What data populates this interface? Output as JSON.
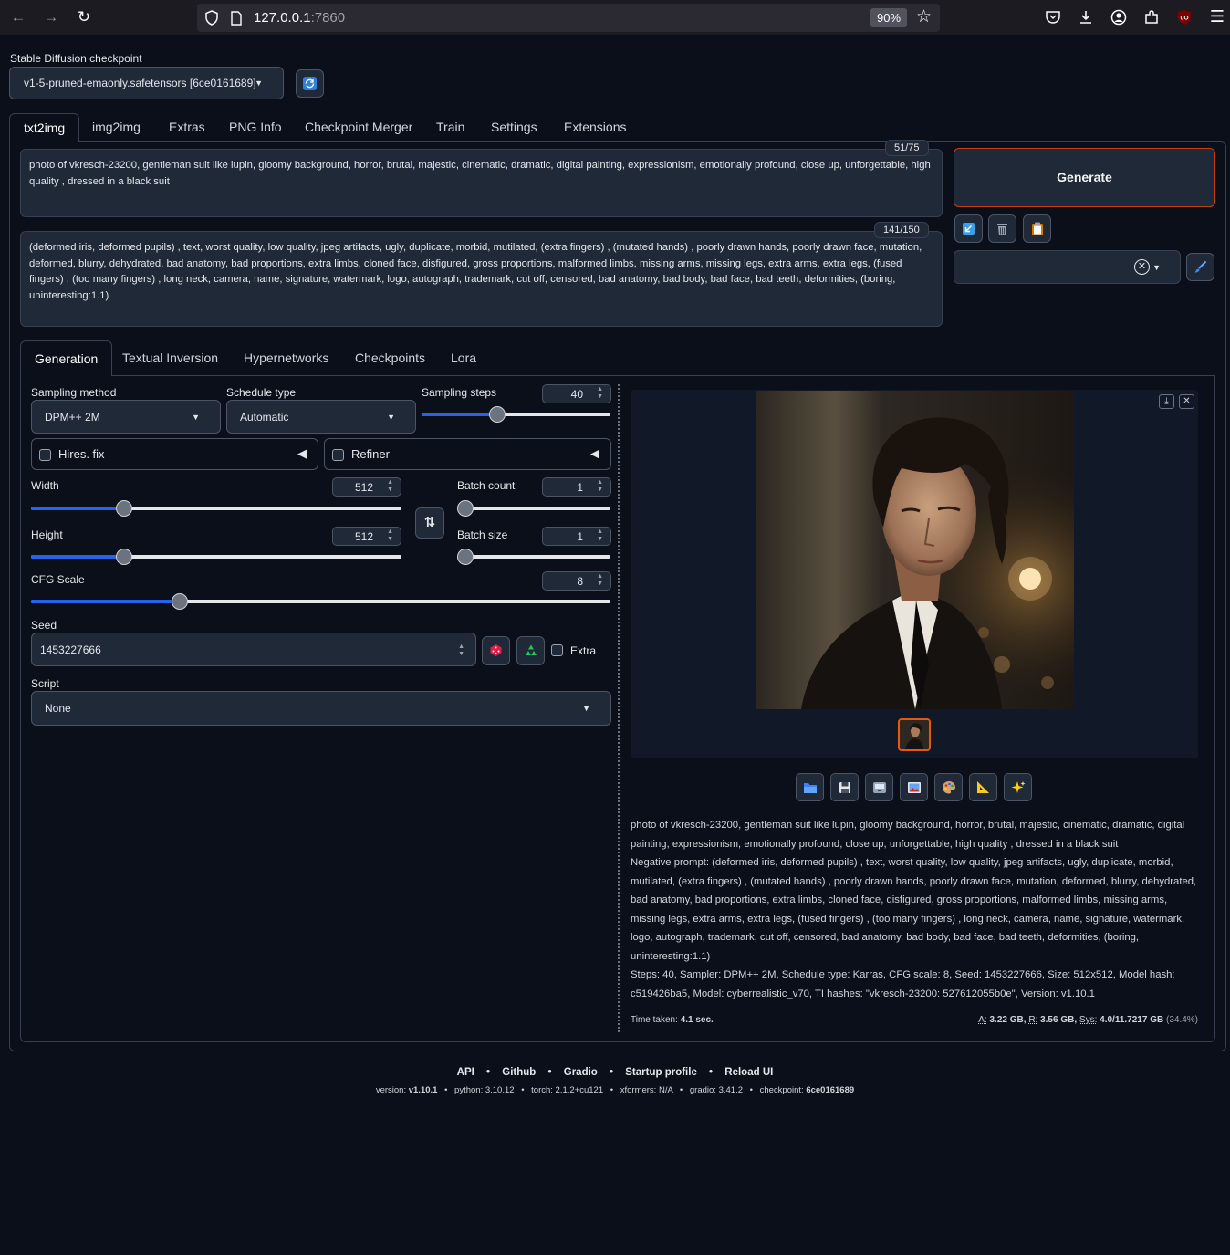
{
  "browser": {
    "url_host": "127.0.0.1",
    "url_port": ":7860",
    "zoom": "90%"
  },
  "checkpoint": {
    "label": "Stable Diffusion checkpoint",
    "value": "v1-5-pruned-emaonly.safetensors [6ce0161689]"
  },
  "main_tabs": [
    "txt2img",
    "img2img",
    "Extras",
    "PNG Info",
    "Checkpoint Merger",
    "Train",
    "Settings",
    "Extensions"
  ],
  "prompt": {
    "text": "photo of vkresch-23200, gentleman suit like lupin, gloomy background, horror, brutal, majestic, cinematic, dramatic, digital painting, expressionism, emotionally profound, close up, unforgettable, high quality , dressed in a black suit",
    "counter": "51/75"
  },
  "negative_prompt": {
    "text": "(deformed iris, deformed pupils) , text, worst quality, low quality, jpeg artifacts, ugly, duplicate, morbid, mutilated, (extra fingers) , (mutated hands) , poorly drawn hands, poorly drawn face, mutation, deformed, blurry, dehydrated, bad anatomy, bad proportions, extra limbs, cloned face, disfigured, gross proportions, malformed limbs, missing arms, missing legs, extra arms, extra legs, (fused fingers) , (too many fingers) , long neck, camera, name, signature, watermark, logo, autograph, trademark, cut off, censored, bad anatomy, bad body, bad face, bad teeth, deformities, (boring, uninteresting:1.1)",
    "counter": "141/150"
  },
  "generate_label": "Generate",
  "sub_tabs": [
    "Generation",
    "Textual Inversion",
    "Hypernetworks",
    "Checkpoints",
    "Lora"
  ],
  "params": {
    "sampling_method_label": "Sampling method",
    "sampling_method": "DPM++ 2M",
    "schedule_type_label": "Schedule type",
    "schedule_type": "Automatic",
    "sampling_steps_label": "Sampling steps",
    "sampling_steps": "40",
    "hires_fix": "Hires. fix",
    "refiner": "Refiner",
    "width_label": "Width",
    "width": "512",
    "height_label": "Height",
    "height": "512",
    "batch_count_label": "Batch count",
    "batch_count": "1",
    "batch_size_label": "Batch size",
    "batch_size": "1",
    "cfg_label": "CFG Scale",
    "cfg": "8",
    "seed_label": "Seed",
    "seed": "1453227666",
    "extra_label": "Extra",
    "script_label": "Script",
    "script": "None"
  },
  "sliders": {
    "sampling_steps": 0.39,
    "width": 0.24,
    "height": 0.24,
    "batch_count": 0.0,
    "batch_size": 0.0,
    "cfg": 0.25
  },
  "output": {
    "info_line1": "photo of vkresch-23200, gentleman suit like lupin, gloomy background, horror, brutal, majestic, cinematic, dramatic, digital painting, expressionism, emotionally profound, close up, unforgettable, high quality , dressed in a black suit",
    "info_line2": "Negative prompt: (deformed iris, deformed pupils) , text, worst quality, low quality, jpeg artifacts, ugly, duplicate, morbid, mutilated, (extra fingers) , (mutated hands) , poorly drawn hands, poorly drawn face, mutation, deformed, blurry, dehydrated, bad anatomy, bad proportions, extra limbs, cloned face, disfigured, gross proportions, malformed limbs, missing arms, missing legs, extra arms, extra legs, (fused fingers) , (too many fingers) , long neck, camera, name, signature, watermark, logo, autograph, trademark, cut off, censored, bad anatomy, bad body, bad face, bad teeth, deformities, (boring, uninteresting:1.1)",
    "info_line3": "Steps: 40, Sampler: DPM++ 2M, Schedule type: Karras, CFG scale: 8, Seed: 1453227666, Size: 512x512, Model hash: c519426ba5, Model: cyberrealistic_v70, TI hashes: \"vkresch-23200: 527612055b0e\", Version: v1.10.1",
    "time_label": "Time taken:",
    "time_value": "4.1 sec.",
    "mem_a_label": "A:",
    "mem_a": "3.22 GB,",
    "mem_r_label": "R:",
    "mem_r": "3.56 GB,",
    "mem_sys_label": "Sys:",
    "mem_sys": "4.0/11.7217 GB",
    "mem_pct": "(34.4%)"
  },
  "footer": {
    "links": [
      "API",
      "Github",
      "Gradio",
      "Startup profile",
      "Reload UI"
    ],
    "version_label": "version:",
    "version": "v1.10.1",
    "python": "python: 3.10.12",
    "torch": "torch: 2.1.2+cu121",
    "xformers": "xformers: N/A",
    "gradio": "gradio: 3.41.2",
    "checkpoint_label": "checkpoint:",
    "checkpoint": "6ce0161689"
  },
  "colors": {
    "background": "#0b0f19",
    "panel": "#1f2937",
    "border": "#374151",
    "accent_blue": "#2563eb",
    "generate_border": "#c2410c"
  }
}
